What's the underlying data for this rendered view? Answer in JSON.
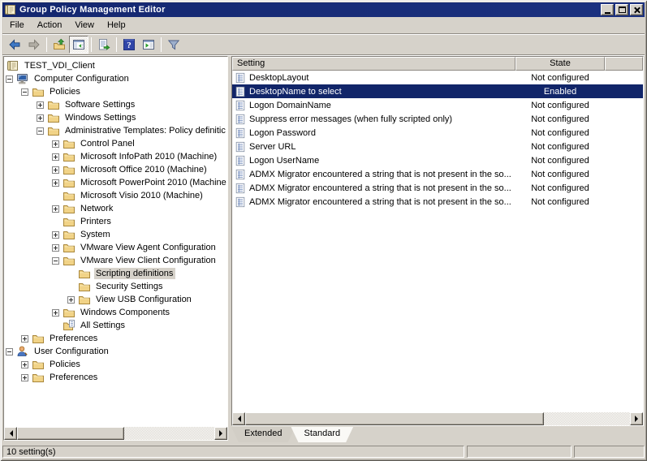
{
  "colors": {
    "face": "#d6d2ca",
    "titlebar_bg": "#14276f",
    "titlebar_text": "#ffffff",
    "selection_bg": "#112569",
    "selection_text": "#ffffff",
    "folder_icon": "#f1d387",
    "pane_bg": "#ffffff"
  },
  "window": {
    "title": "Group Policy Management Editor",
    "icon": "gpo-scroll",
    "controls": [
      {
        "name": "minimize",
        "glyph": "minimize-icon"
      },
      {
        "name": "maximize",
        "glyph": "maximize-icon"
      },
      {
        "name": "close",
        "glyph": "close-icon"
      }
    ]
  },
  "menu": {
    "items": [
      "File",
      "Action",
      "View",
      "Help"
    ]
  },
  "toolbar": {
    "buttons": [
      {
        "kind": "button",
        "name": "back",
        "icon": "back",
        "disabled": false
      },
      {
        "kind": "button",
        "name": "forward",
        "icon": "forward",
        "disabled": true
      },
      {
        "kind": "separator"
      },
      {
        "kind": "button",
        "name": "up-one-level",
        "icon": "up-one-level"
      },
      {
        "kind": "button",
        "name": "show-console-tree",
        "icon": "console-tree",
        "pressed": true
      },
      {
        "kind": "separator"
      },
      {
        "kind": "button",
        "name": "export-list",
        "icon": "export-list"
      },
      {
        "kind": "separator"
      },
      {
        "kind": "button",
        "name": "help",
        "icon": "help"
      },
      {
        "kind": "button",
        "name": "show-properties",
        "icon": "properties-window"
      },
      {
        "kind": "separator"
      },
      {
        "kind": "button",
        "name": "filter",
        "icon": "filter"
      }
    ]
  },
  "tree": {
    "items": [
      {
        "label": "TEST_VDI_Client",
        "level": 0,
        "expand": "none",
        "icon": "gpo-scroll",
        "selected": false
      },
      {
        "label": "Computer Configuration",
        "level": 1,
        "expand": "minus",
        "icon": "computer",
        "selected": false
      },
      {
        "label": "Policies",
        "level": 2,
        "expand": "minus",
        "icon": "folder",
        "selected": false
      },
      {
        "label": "Software Settings",
        "level": 3,
        "expand": "plus",
        "icon": "folder",
        "selected": false
      },
      {
        "label": "Windows Settings",
        "level": 3,
        "expand": "plus",
        "icon": "folder",
        "selected": false
      },
      {
        "label": "Administrative Templates: Policy definitic",
        "level": 3,
        "expand": "minus",
        "icon": "folder",
        "selected": false
      },
      {
        "label": "Control Panel",
        "level": 4,
        "expand": "plus",
        "icon": "folder",
        "selected": false
      },
      {
        "label": "Microsoft InfoPath 2010 (Machine)",
        "level": 4,
        "expand": "plus",
        "icon": "folder",
        "selected": false
      },
      {
        "label": "Microsoft Office 2010 (Machine)",
        "level": 4,
        "expand": "plus",
        "icon": "folder",
        "selected": false
      },
      {
        "label": "Microsoft PowerPoint 2010 (Machine",
        "level": 4,
        "expand": "plus",
        "icon": "folder",
        "selected": false
      },
      {
        "label": "Microsoft Visio 2010 (Machine)",
        "level": 4,
        "expand": "none",
        "icon": "folder",
        "selected": false
      },
      {
        "label": "Network",
        "level": 4,
        "expand": "plus",
        "icon": "folder",
        "selected": false
      },
      {
        "label": "Printers",
        "level": 4,
        "expand": "none",
        "icon": "folder",
        "selected": false
      },
      {
        "label": "System",
        "level": 4,
        "expand": "plus",
        "icon": "folder",
        "selected": false
      },
      {
        "label": "VMware View Agent Configuration",
        "level": 4,
        "expand": "plus",
        "icon": "folder",
        "selected": false
      },
      {
        "label": "VMware View Client Configuration",
        "level": 4,
        "expand": "minus",
        "icon": "folder",
        "selected": false
      },
      {
        "label": "Scripting definitions",
        "level": 5,
        "expand": "none",
        "icon": "folder",
        "selected": true
      },
      {
        "label": "Security Settings",
        "level": 5,
        "expand": "none",
        "icon": "folder",
        "selected": false
      },
      {
        "label": "View USB Configuration",
        "level": 5,
        "expand": "plus",
        "icon": "folder",
        "selected": false
      },
      {
        "label": "Windows Components",
        "level": 4,
        "expand": "plus",
        "icon": "folder",
        "selected": false
      },
      {
        "label": "All Settings",
        "level": 4,
        "expand": "none",
        "icon": "all-settings",
        "selected": false
      },
      {
        "label": "Preferences",
        "level": 2,
        "expand": "plus",
        "icon": "folder",
        "selected": false
      },
      {
        "label": "User Configuration",
        "level": 1,
        "expand": "minus",
        "icon": "user",
        "selected": false
      },
      {
        "label": "Policies",
        "level": 2,
        "expand": "plus",
        "icon": "folder",
        "selected": false
      },
      {
        "label": "Preferences",
        "level": 2,
        "expand": "plus",
        "icon": "folder",
        "selected": false
      }
    ]
  },
  "list": {
    "columns": [
      {
        "label": "Setting"
      },
      {
        "label": "State"
      },
      {
        "label": ""
      }
    ],
    "rows": [
      {
        "setting": "DesktopLayout",
        "state": "Not configured",
        "selected": false
      },
      {
        "setting": "DesktopName to select",
        "state": "Enabled",
        "selected": true
      },
      {
        "setting": "Logon DomainName",
        "state": "Not configured",
        "selected": false
      },
      {
        "setting": "Suppress error messages (when fully scripted only)",
        "state": "Not configured",
        "selected": false
      },
      {
        "setting": "Logon Password",
        "state": "Not configured",
        "selected": false
      },
      {
        "setting": "Server URL",
        "state": "Not configured",
        "selected": false
      },
      {
        "setting": "Logon UserName",
        "state": "Not configured",
        "selected": false
      },
      {
        "setting": "ADMX Migrator encountered a string that is not present in the so...",
        "state": "Not configured",
        "selected": false
      },
      {
        "setting": "ADMX Migrator encountered a string that is not present in the so...",
        "state": "Not configured",
        "selected": false
      },
      {
        "setting": "ADMX Migrator encountered a string that is not present in the so...",
        "state": "Not configured",
        "selected": false
      }
    ]
  },
  "tabs": {
    "items": [
      {
        "label": "Extended",
        "active": false
      },
      {
        "label": "Standard",
        "active": true
      }
    ]
  },
  "status": {
    "panels": [
      "10 setting(s)",
      "",
      ""
    ]
  }
}
